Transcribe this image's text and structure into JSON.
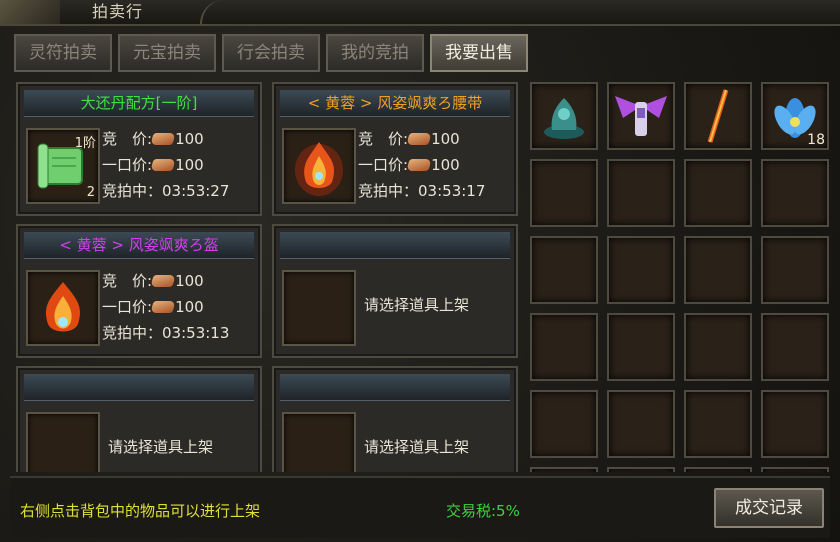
{
  "window": {
    "title": "拍卖行"
  },
  "tabs": [
    {
      "label": "灵符拍卖",
      "active": false
    },
    {
      "label": "元宝拍卖",
      "active": false
    },
    {
      "label": "行会拍卖",
      "active": false
    },
    {
      "label": "我的竞拍",
      "active": false
    },
    {
      "label": "我要出售",
      "active": true
    }
  ],
  "price_labels": {
    "bid": "竞　价:",
    "buyout": "一口价:",
    "time": "竞拍中：",
    "currency_icon": "ingot-icon"
  },
  "listings": [
    {
      "name": "大还丹配方[一阶]",
      "name_color": "#3fe03f",
      "level_tag": "1阶",
      "count": "2",
      "bid": "100",
      "buyout": "100",
      "time_left": "03:53:27",
      "icon": "green-scroll-icon"
    },
    {
      "name": "< 黄蓉 > 风姿飒爽ろ腰带",
      "name_color": "#f0a020",
      "bid": "100",
      "buyout": "100",
      "time_left": "03:53:17",
      "icon": "flame-belt-icon"
    },
    {
      "name": "< 黄蓉 > 风姿飒爽ろ盔",
      "name_color": "#d040f0",
      "bid": "100",
      "buyout": "100",
      "time_left": "03:53:13",
      "icon": "flame-helmet-icon"
    }
  ],
  "empty_slot_label": "请选择道具上架",
  "bag_items": [
    {
      "icon": "jade-pagoda-icon",
      "count": ""
    },
    {
      "icon": "winged-armor-icon",
      "count": ""
    },
    {
      "icon": "flame-sword-icon",
      "count": ""
    },
    {
      "icon": "blue-lotus-icon",
      "count": "18"
    }
  ],
  "footer": {
    "hint": "右侧点击背包中的物品可以进行上架",
    "tax": "交易税:5%",
    "records_button": "成交记录"
  },
  "colors": {
    "hint": "#dde033",
    "tax": "#3fd23f"
  }
}
